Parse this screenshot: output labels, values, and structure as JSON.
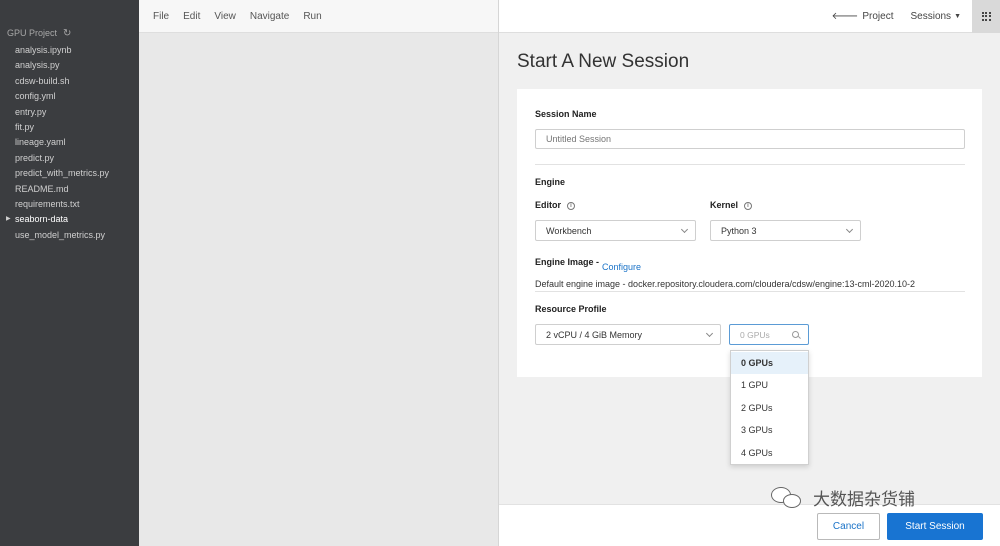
{
  "sidebar": {
    "project_name": "GPU Project",
    "files": [
      {
        "name": "analysis.ipynb",
        "folder": false
      },
      {
        "name": "analysis.py",
        "folder": false
      },
      {
        "name": "cdsw-build.sh",
        "folder": false
      },
      {
        "name": "config.yml",
        "folder": false
      },
      {
        "name": "entry.py",
        "folder": false
      },
      {
        "name": "fit.py",
        "folder": false
      },
      {
        "name": "lineage.yaml",
        "folder": false
      },
      {
        "name": "predict.py",
        "folder": false
      },
      {
        "name": "predict_with_metrics.py",
        "folder": false
      },
      {
        "name": "README.md",
        "folder": false
      },
      {
        "name": "requirements.txt",
        "folder": false
      },
      {
        "name": "seaborn-data",
        "folder": true
      },
      {
        "name": "use_model_metrics.py",
        "folder": false
      }
    ]
  },
  "menu": {
    "items": [
      "File",
      "Edit",
      "View",
      "Navigate",
      "Run"
    ]
  },
  "topbar": {
    "project_label": "Project",
    "sessions_label": "Sessions"
  },
  "page": {
    "title": "Start A New Session"
  },
  "form": {
    "session_name_label": "Session Name",
    "session_name_placeholder": "Untitled Session",
    "session_name_value": "",
    "engine_label": "Engine",
    "editor_label": "Editor",
    "editor_value": "Workbench",
    "kernel_label": "Kernel",
    "kernel_value": "Python 3",
    "engine_image_label": "Engine Image -",
    "configure_link": "Configure",
    "engine_image_text": "Default engine image - docker.repository.cloudera.com/cloudera/cdsw/engine:13-cml-2020.10-2",
    "resource_profile_label": "Resource Profile",
    "resource_profile_value": "2 vCPU / 4 GiB Memory",
    "gpu_placeholder": "0 GPUs",
    "gpu_options": [
      "0 GPUs",
      "1 GPU",
      "2 GPUs",
      "3 GPUs",
      "4 GPUs"
    ],
    "gpu_selected_index": 0
  },
  "footer": {
    "cancel_label": "Cancel",
    "start_label": "Start Session"
  },
  "watermark": {
    "text": "大数据杂货铺"
  },
  "colors": {
    "sidebar_bg": "#3b3d40",
    "primary": "#1874d2",
    "link": "#1a73c8"
  }
}
